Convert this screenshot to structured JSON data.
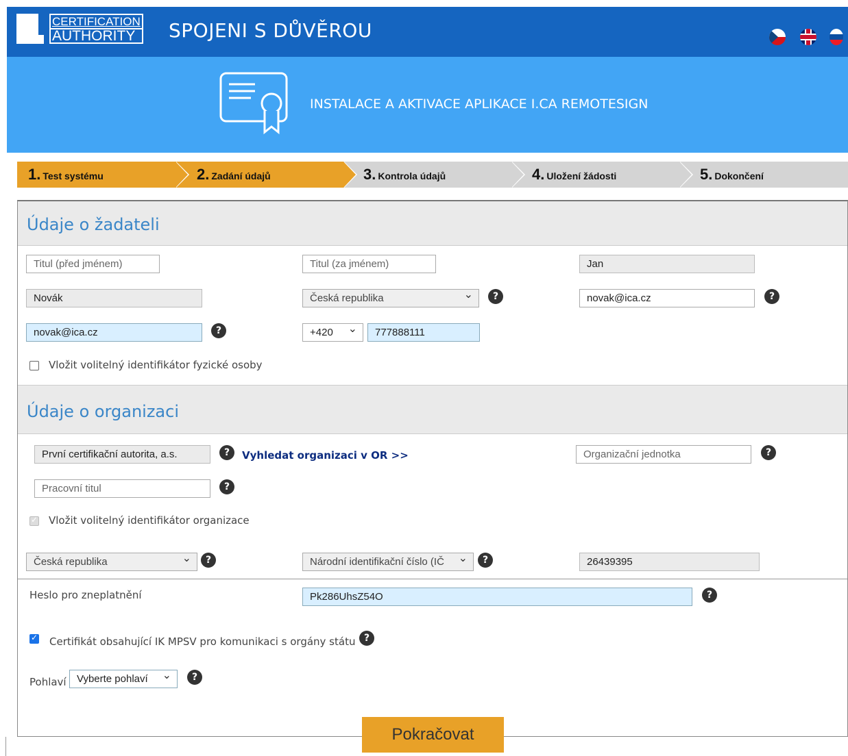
{
  "header": {
    "logo_line1": "CERTIFICATION",
    "logo_line2": "AUTHORITY",
    "logo_mark": "I.",
    "title": "SPOJENI S DŮVĚROU",
    "languages": [
      "cz-flag-icon",
      "uk-flag-icon",
      "sk-flag-icon"
    ]
  },
  "hero": {
    "icon": "certificate-icon",
    "title": "INSTALACE A AKTIVACE APLIKACE I.CA REMOTESIGN"
  },
  "steps": [
    {
      "num": "1.",
      "label": "Test systému",
      "state": "done"
    },
    {
      "num": "2.",
      "label": "Zadání údajů",
      "state": "active"
    },
    {
      "num": "3.",
      "label": "Kontrola údajů",
      "state": "pending"
    },
    {
      "num": "4.",
      "label": "Uložení žádosti",
      "state": "pending"
    },
    {
      "num": "5.",
      "label": "Dokončení",
      "state": "pending"
    }
  ],
  "applicant": {
    "heading": "Údaje o žadateli",
    "title_before_placeholder": "Titul (před jménem)",
    "title_after_placeholder": "Titul (za jménem)",
    "first_name": "Jan",
    "last_name": "Novák",
    "country": "Česká republika",
    "email": "novak@ica.cz",
    "email_confirm": "novak@ica.cz",
    "phone_prefix": "+420",
    "phone": "777888111",
    "optional_id_label": "Vložit volitelný identifikátor fyzické osoby",
    "optional_id_checked": false
  },
  "organization": {
    "heading": "Údaje o organizaci",
    "name": "První certifikační autorita, a.s.",
    "search_link": "Vyhledat organizaci v OR >>",
    "unit_placeholder": "Organizační jednotka",
    "job_title_placeholder": "Pracovní titul",
    "optional_id_label": "Vložit volitelný identifikátor organizace",
    "optional_id_checked": true,
    "country": "Česká republika",
    "id_type": "Národní identifikační číslo (IČ",
    "id_value": "26439395"
  },
  "extra": {
    "revocation_label": "Heslo pro zneplatnění",
    "revocation_value": "Pk286UhsZ54O",
    "mpsv_label": "Certifikát obsahující IK MPSV pro komunikaci s orgány státu",
    "mpsv_checked": true,
    "gender_label": "Pohlaví",
    "gender_value": "Vyberte pohlaví"
  },
  "help_icon": "?",
  "continue_label": "Pokračovat"
}
